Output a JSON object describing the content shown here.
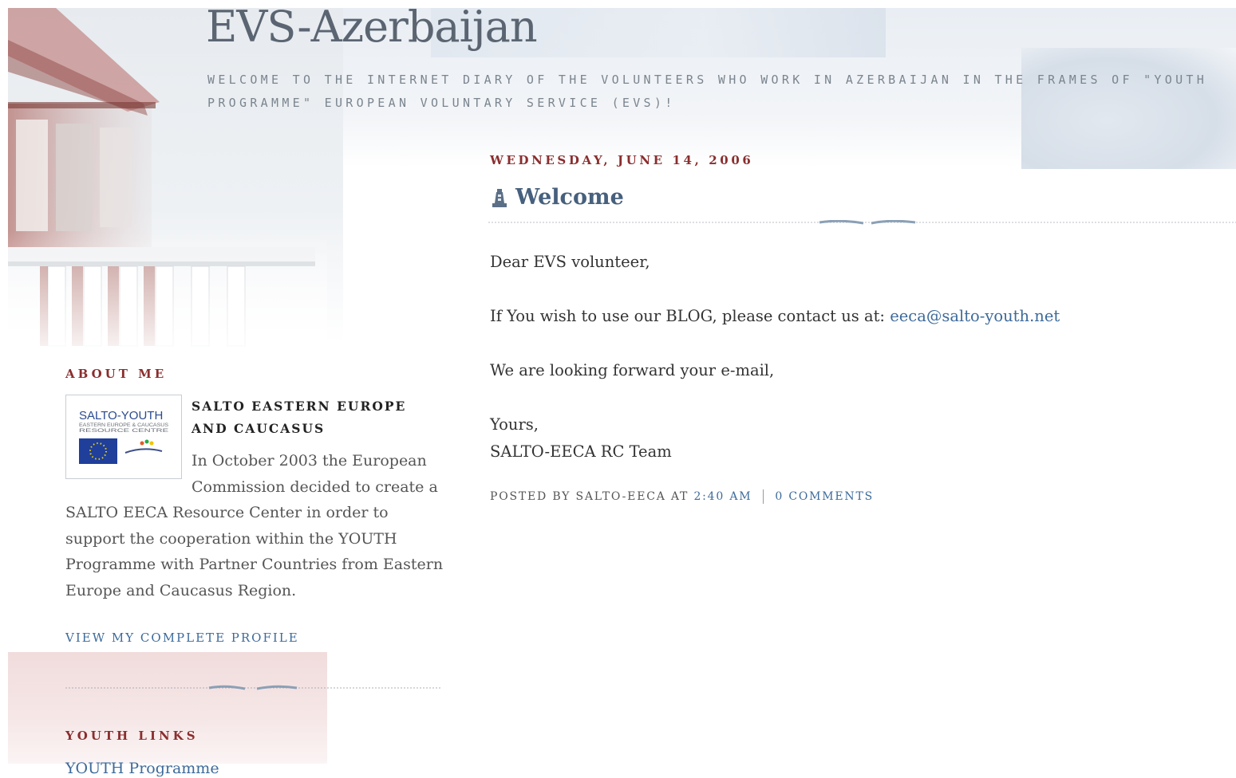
{
  "header": {
    "blog_title": "EVS-Azerbaijan",
    "description": "WELCOME TO THE INTERNET DIARY OF THE VOLUNTEERS WHO WORK IN AZERBAIJAN IN THE FRAMES OF \"YOUTH PROGRAMME\" EUROPEAN VOLUNTARY SERVICE (EVS)!"
  },
  "post": {
    "date": "WEDNESDAY, JUNE 14, 2006",
    "title": "Welcome",
    "title_icon": "post-lighthouse-icon",
    "greeting": "Dear EVS volunteer,",
    "contact_text": "If You wish to use our BLOG, please contact us at:",
    "contact_email": "eeca@salto-youth.net",
    "looking_forward": "We are looking forward your e-mail,",
    "sign_off": "Yours,",
    "signature": "SALTO-EECA RC Team",
    "posted_by_label": "POSTED BY SALTO-EECA AT",
    "time": "2:40 AM",
    "comments": "0 COMMENTS"
  },
  "sidebar": {
    "about_heading": "ABOUT ME",
    "profile_name": "SALTO EASTERN EUROPE AND CAUCASUS",
    "profile_image_text": {
      "line1": "SALTO-YOUTH",
      "line2": "EASTERN EUROPE & CAUCASUS",
      "line3": "RESOURCE CENTRE"
    },
    "profile_description": "In October 2003 the European Commission decided to create a SALTO EECA Resource Center in order to support the cooperation within the YOUTH Programme with Partner Countries from Eastern Europe and Caucasus Region.",
    "view_profile": "VIEW MY COMPLETE PROFILE",
    "links_heading": "YOUTH LINKS",
    "links": [
      "YOUTH Programme"
    ]
  },
  "colors": {
    "accent_red": "#8a2e2e",
    "link_blue": "#3d6a9a",
    "title_gray": "#5b6572"
  }
}
